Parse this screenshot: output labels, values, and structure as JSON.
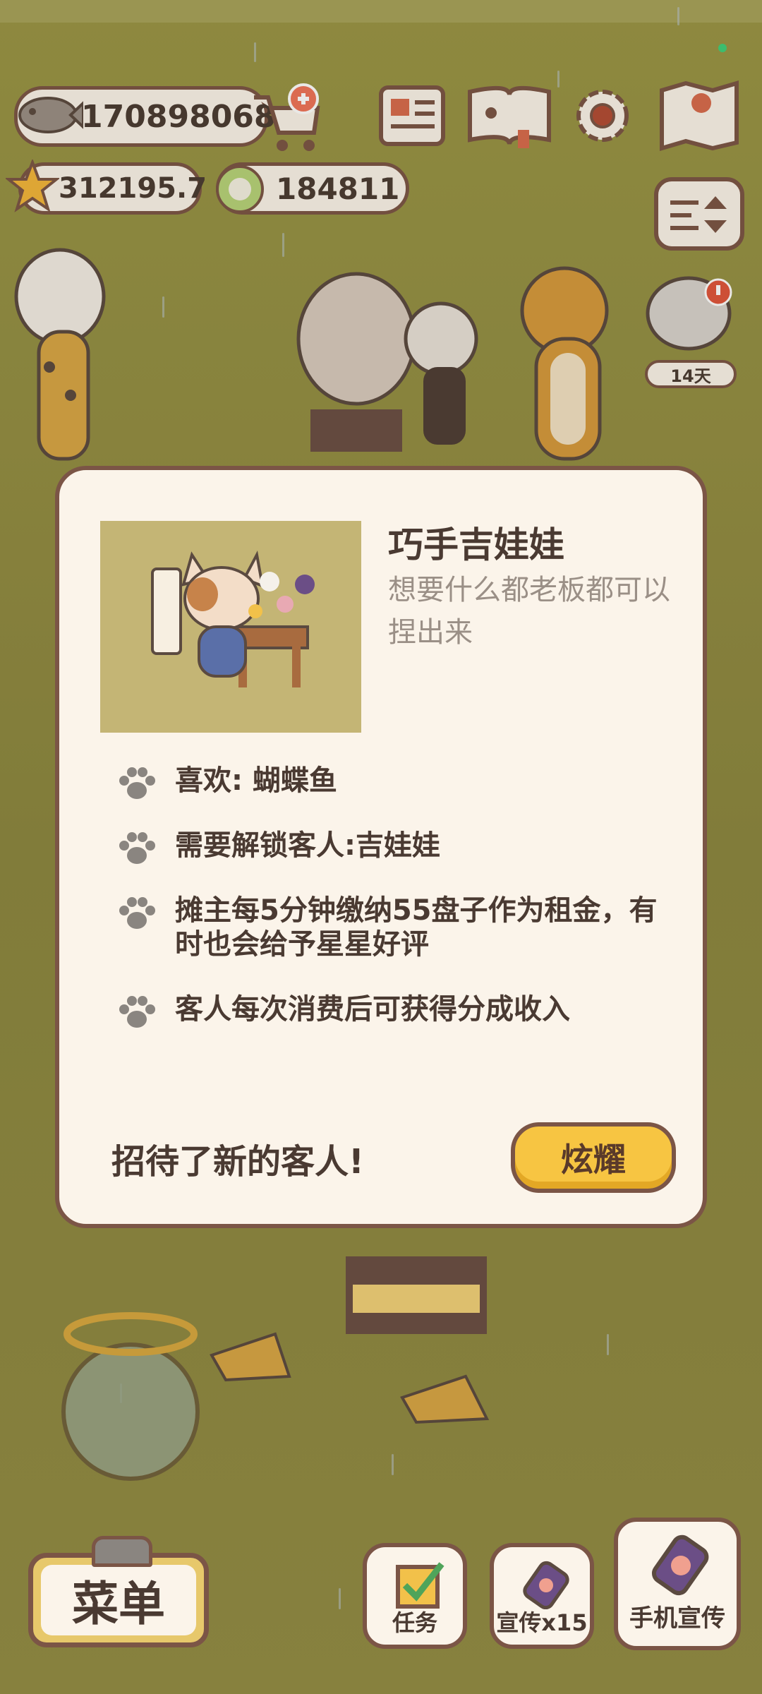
{
  "hud": {
    "fish_count": "170898068",
    "star_count": "312195.7",
    "plate_count": "184811",
    "event_badge": "14天"
  },
  "dialog": {
    "title": "巧手吉娃娃",
    "subtitle": "想要什么都老板都可以捏出来",
    "rows": [
      "喜欢: 蝴蝶鱼",
      "需要解锁客人:吉娃娃",
      "摊主每5分钟缴纳55盘子作为租金，有时也会给予星星好评",
      "客人每次消费后可获得分成收入"
    ],
    "footer_text": "招待了新的客人!",
    "brag_button": "炫耀"
  },
  "bottom_bar": {
    "menu": "菜单",
    "tasks": "任务",
    "promote": "宣传x15",
    "phone_promote": "手机宣传"
  },
  "colors": {
    "background": "#8f8a3f",
    "panel": "#fbf4ea",
    "border": "#7b5546",
    "accent_button": "#f7c542"
  }
}
